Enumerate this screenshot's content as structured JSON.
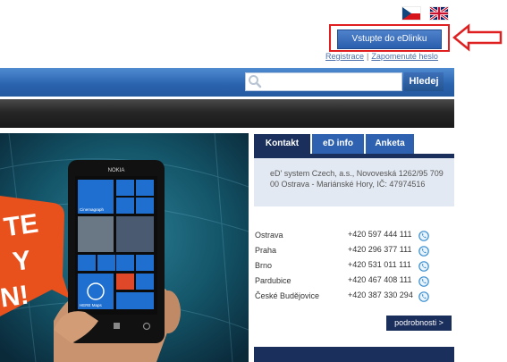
{
  "header": {
    "flags": [
      {
        "name": "czech-flag",
        "label": ""
      },
      {
        "name": "uk-flag",
        "label": ""
      }
    ],
    "login_button_label": "Vstupte do eDlinku",
    "register_link": "Registrace",
    "forgot_password_link": "Zapomenuté heslo",
    "separator": "|"
  },
  "search": {
    "placeholder": "",
    "button_label": "Hledej"
  },
  "banner": {
    "phone_brand": "NOKIA",
    "promo_letters": [
      "TE",
      "Y",
      "N!"
    ],
    "tile_labels": [
      "Cinemagraph",
      "HERE Maps"
    ],
    "accent_color": "#e8501c"
  },
  "sidebar": {
    "tabs": [
      {
        "label": "Kontakt",
        "active": true
      },
      {
        "label": "eD info",
        "active": false
      },
      {
        "label": "Anketa",
        "active": false
      }
    ],
    "address": "eD' system Czech, a.s., Novoveská 1262/95 709 00   Ostrava - Mariánské Hory, IČ: 47974516",
    "contacts": [
      {
        "city": "Ostrava",
        "phone": "+420 597 444 111"
      },
      {
        "city": "Praha",
        "phone": "+420 296 377 111"
      },
      {
        "city": "Brno",
        "phone": "+420 531 011 111"
      },
      {
        "city": "Pardubice",
        "phone": "+420 467 408 111"
      },
      {
        "city": "České Budějovice",
        "phone": "+420 387 330 294"
      }
    ],
    "more_button_label": "podrobnosti >"
  },
  "colors": {
    "primary_blue": "#2a62ad",
    "dark_navy": "#1b2f5c",
    "highlight_red": "#e02020",
    "nav_dark": "#1a1a1a"
  }
}
